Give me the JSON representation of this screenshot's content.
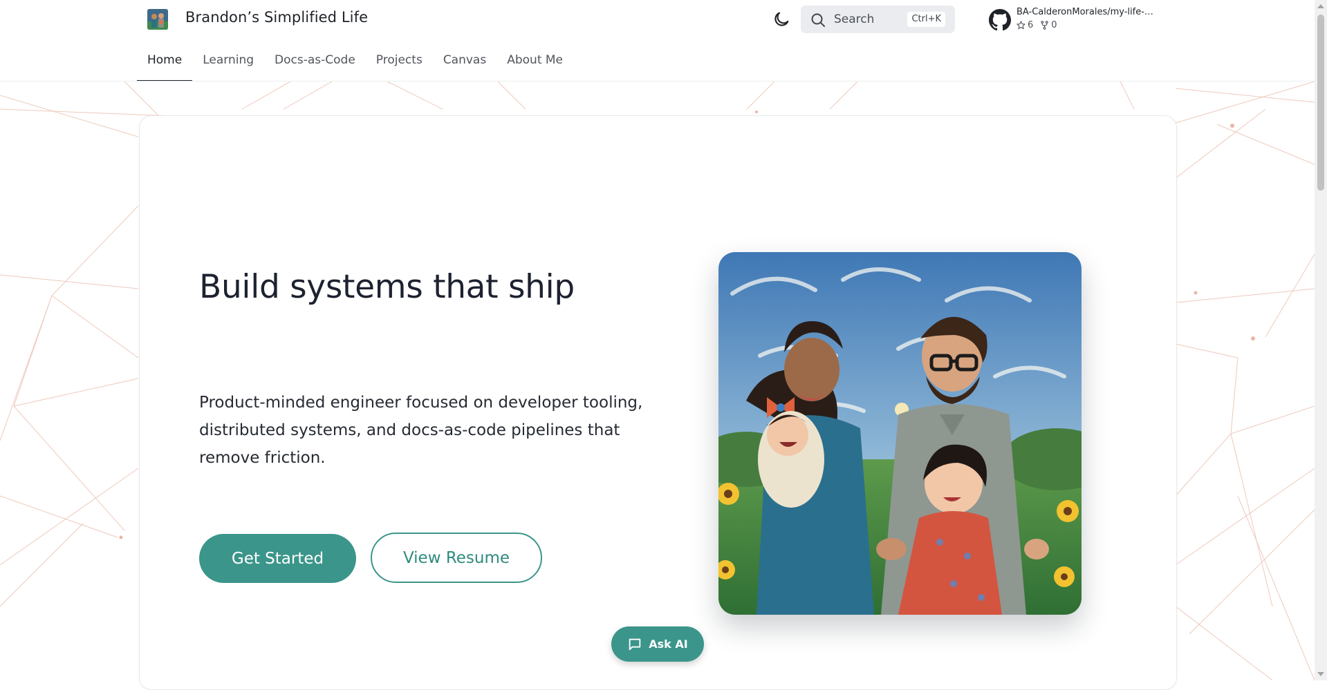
{
  "header": {
    "site_title": "Brandon’s Simplified Life",
    "logo_icon": "family-logo-icon",
    "theme_toggle_icon": "moon-icon",
    "search": {
      "label": "Search",
      "shortcut": "Ctrl+K",
      "icon": "search-icon"
    },
    "repo": {
      "name": "BA-CalderonMorales/my-life-…",
      "stars": "6",
      "forks": "0",
      "icon": "github-icon"
    }
  },
  "nav": {
    "tabs": [
      {
        "label": "Home",
        "active": true
      },
      {
        "label": "Learning",
        "active": false
      },
      {
        "label": "Docs-as-Code",
        "active": false
      },
      {
        "label": "Projects",
        "active": false
      },
      {
        "label": "Canvas",
        "active": false
      },
      {
        "label": "About Me",
        "active": false
      }
    ]
  },
  "hero": {
    "title": "Build systems that ship",
    "description": "Product-minded engineer focused on developer tooling, distributed systems, and docs-as-code pipelines that remove friction.",
    "primary_button": "Get Started",
    "secondary_button": "View Resume",
    "image_icon": "family-illustration"
  },
  "ask_ai": {
    "label": "Ask AI",
    "icon": "chat-bubble-icon"
  },
  "colors": {
    "accent": "#3b958a",
    "network_lines": "#e9b4a0",
    "text": "#1f2328"
  }
}
